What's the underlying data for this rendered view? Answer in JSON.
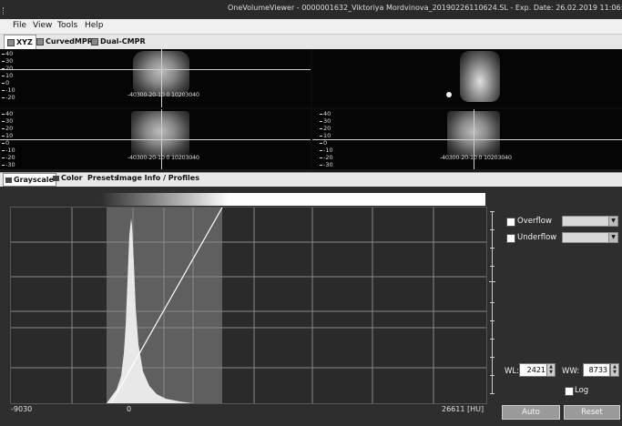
{
  "window": {
    "title": "OneVolumeViewer - 0000001632_Viktoriya Mordvinova_20190226110624.SL - Exp. Date: 26.02.2019 11:06:24"
  },
  "menu": {
    "items": [
      "File",
      "View",
      "Tools",
      "Help"
    ]
  },
  "view_tabs": [
    {
      "label": "XYZ",
      "active": true
    },
    {
      "label": "CurvedMPR",
      "active": false
    },
    {
      "label": "Dual-CMPR",
      "active": false
    }
  ],
  "viewports": {
    "ruler_ticks": [
      "40",
      "30",
      "20",
      "10",
      "0",
      "-10",
      "-20",
      "-30",
      "-40"
    ],
    "hruler_text": "-40300-20-10 0 10203040",
    "hruler_text_br": "-40300-20-10 0 10203040"
  },
  "panel_tabs": [
    {
      "label": "Grayscale",
      "active": true
    },
    {
      "label": "Color",
      "active": false
    },
    {
      "label": "Presets",
      "active": false
    },
    {
      "label": "Image Info / Profiles",
      "active": false
    }
  ],
  "histogram": {
    "min_label": "-9030",
    "zero_label": "0",
    "max_label": "26611 [HU]"
  },
  "controls": {
    "overflow_label": "Overflow",
    "underflow_label": "Underflow",
    "wl_label": "WL:",
    "wl_value": "2421",
    "ww_label": "WW:",
    "ww_value": "8733",
    "log_label": "Log",
    "auto_label": "Auto",
    "reset_label": "Reset"
  }
}
